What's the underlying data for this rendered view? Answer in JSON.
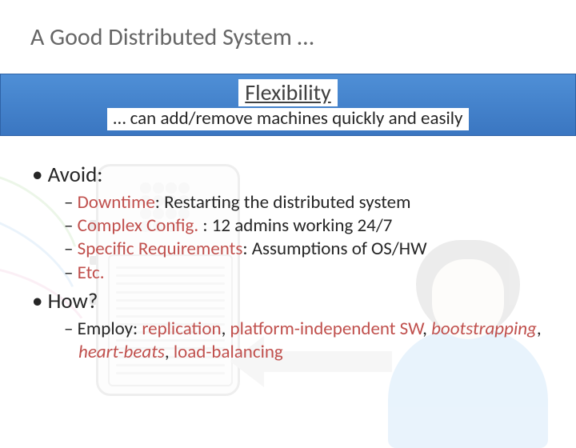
{
  "title": "A Good Distributed System …",
  "callout": {
    "heading": "Flexibility",
    "sub": "… can add/remove machines quickly and easily"
  },
  "avoid": {
    "label": "Avoid:",
    "items": [
      {
        "term": "Downtime",
        "rest": ": Restarting the distributed system"
      },
      {
        "term": "Complex Config.",
        "rest": " : 12 admins working 24/7"
      },
      {
        "term": "Specific Requirements",
        "rest": ": Assumptions of OS/HW"
      },
      {
        "term": "Etc.",
        "rest": ""
      }
    ]
  },
  "how": {
    "label": "How?",
    "prefix": "Employ: ",
    "kw": {
      "a": "replication",
      "b": "platform-independent SW",
      "c": "bootstrapping",
      "d": "heart-beats",
      "e": "load-balancing"
    },
    "sep": ", "
  }
}
